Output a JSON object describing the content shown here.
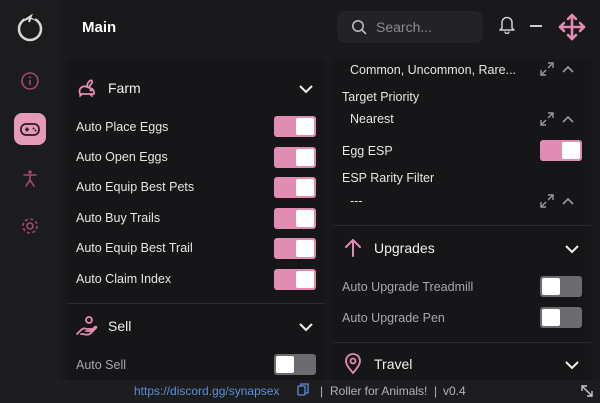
{
  "header": {
    "title": "Main",
    "search_placeholder": "Search..."
  },
  "sidebar": {
    "items": [
      {
        "icon": "info-icon",
        "active": false
      },
      {
        "icon": "gamepad-icon",
        "active": true
      },
      {
        "icon": "figure-icon",
        "active": false
      },
      {
        "icon": "gear-icon",
        "active": false
      }
    ]
  },
  "farm": {
    "title": "Farm",
    "rows": [
      {
        "label": "Auto Place Eggs",
        "on": true
      },
      {
        "label": "Auto Open Eggs",
        "on": true
      },
      {
        "label": "Auto Equip Best Pets",
        "on": true
      },
      {
        "label": "Auto Buy Trails",
        "on": true
      },
      {
        "label": "Auto Equip Best Trail",
        "on": true
      },
      {
        "label": "Auto Claim Index",
        "on": true
      }
    ]
  },
  "sell": {
    "title": "Sell",
    "rows": [
      {
        "label": "Auto Sell",
        "on": false
      }
    ]
  },
  "right": {
    "rarity_value": "Common, Uncommon, Rare...",
    "target_priority_label": "Target Priority",
    "target_priority_value": "Nearest",
    "egg_esp_label": "Egg ESP",
    "egg_esp_on": true,
    "esp_rarity_label": "ESP Rarity Filter",
    "esp_rarity_value": "---"
  },
  "upgrades": {
    "title": "Upgrades",
    "rows": [
      {
        "label": "Auto Upgrade Treadmill",
        "on": false
      },
      {
        "label": "Auto Upgrade Pen",
        "on": false
      }
    ]
  },
  "travel": {
    "title": "Travel"
  },
  "footer": {
    "link": "https://discord.gg/synapsex",
    "separator1": "|",
    "game": "Roller for Animals!",
    "separator2": "|",
    "version": "v0.4"
  },
  "colors": {
    "accent": "#e18cb2",
    "background": "#19191b",
    "link": "#5b8fd8"
  }
}
